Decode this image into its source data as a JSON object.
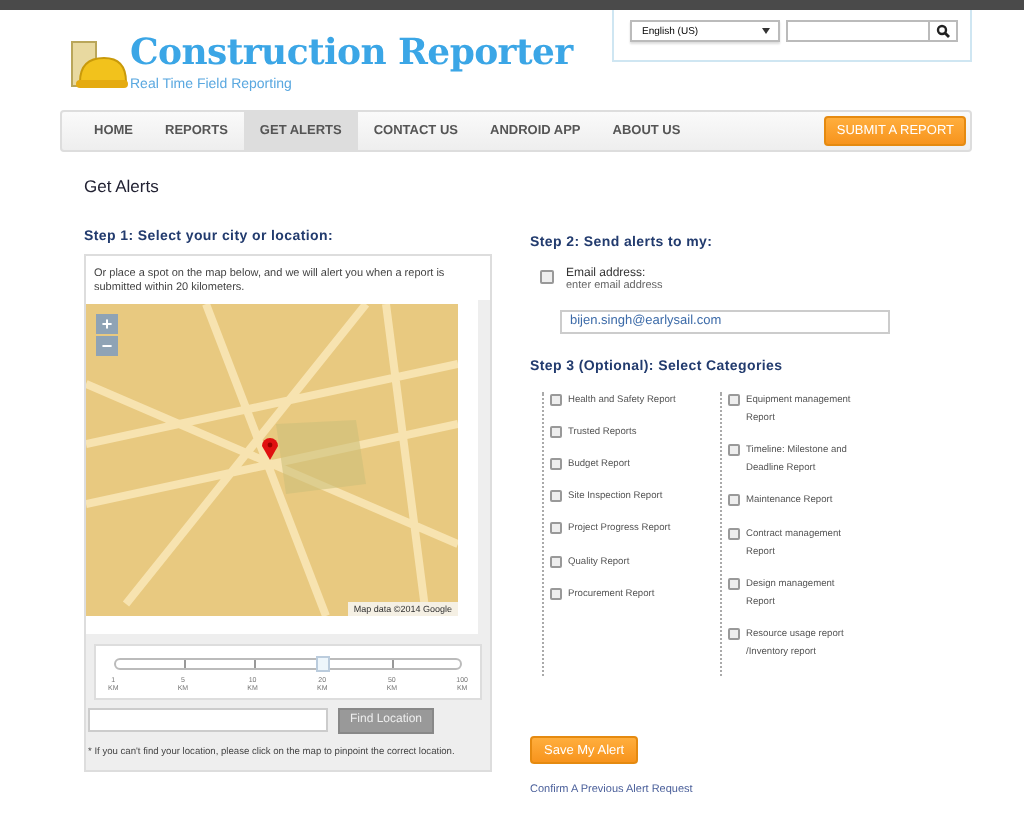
{
  "header": {
    "logo_title": "Construction Reporter",
    "tagline": "Real Time Field Reporting",
    "language": "English (US)"
  },
  "nav": {
    "items": [
      {
        "label": "HOME",
        "selected": false
      },
      {
        "label": "REPORTS",
        "selected": false
      },
      {
        "label": "GET ALERTS",
        "selected": true
      },
      {
        "label": "CONTACT US",
        "selected": false
      },
      {
        "label": "ANDROID APP",
        "selected": false
      },
      {
        "label": "ABOUT US",
        "selected": false
      }
    ],
    "submit_button": "SUBMIT A REPORT"
  },
  "page_title": "Get Alerts",
  "step1": {
    "heading": "Step 1: Select your city or location:",
    "instructions": "Or place a spot on the map below, and we will alert you when a report is submitted within 20 kilometers.",
    "map": {
      "zoom_in": "+",
      "zoom_out": "−",
      "attribution": "Map data ©2014 Google"
    },
    "radius": {
      "level": 0.6,
      "ticks": [
        {
          "value": "1",
          "unit": "KM"
        },
        {
          "value": "5",
          "unit": "KM"
        },
        {
          "value": "10",
          "unit": "KM"
        },
        {
          "value": "20",
          "unit": "KM"
        },
        {
          "value": "50",
          "unit": "KM"
        },
        {
          "value": "100",
          "unit": "KM"
        }
      ]
    },
    "find_button": "Find Location",
    "note": "* If you can't find your location, please click on the map to pinpoint the correct location."
  },
  "step2": {
    "heading": "Step 2: Send alerts to my:",
    "email": {
      "checked": false,
      "label": "Email address:",
      "hint": "enter email address",
      "value": "bijen.singh@earlysail.com"
    }
  },
  "step3": {
    "heading": "Step 3 (Optional): Select Categories",
    "columns": [
      [
        {
          "label": "Health and Safety Report",
          "checked": false
        },
        {
          "label": "Trusted Reports",
          "checked": false
        },
        {
          "label": "Budget Report",
          "checked": false
        },
        {
          "label": "Site Inspection Report",
          "checked": false
        },
        {
          "label": "Project Progress Report",
          "checked": false
        },
        {
          "label": "Quality Report",
          "checked": false
        },
        {
          "label": "Procurement Report",
          "checked": false
        }
      ],
      [
        {
          "label": "Equipment management Report",
          "checked": false
        },
        {
          "label": "Timeline: Milestone and Deadline Report",
          "checked": false
        },
        {
          "label": "Maintenance Report",
          "checked": false
        },
        {
          "label": "Contract management Report",
          "checked": false
        },
        {
          "label": "Design management Report",
          "checked": false
        },
        {
          "label": "Resource usage report /Inventory report",
          "checked": false
        }
      ]
    ]
  },
  "save_button": "Save My Alert",
  "confirm_link": "Confirm A Previous Alert Request"
}
